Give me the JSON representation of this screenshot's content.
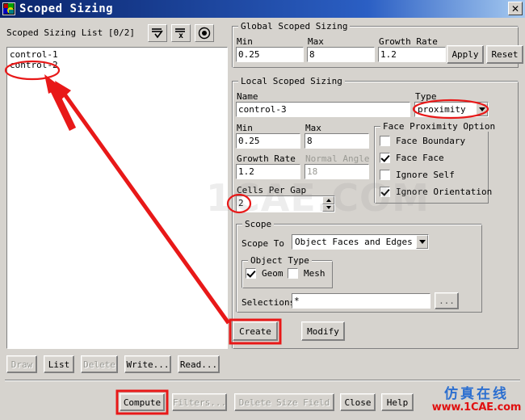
{
  "window": {
    "title": "Scoped Sizing",
    "icon": "mesh-app-icon",
    "close_label": "✕"
  },
  "left_panel": {
    "list_label": "Scoped Sizing List  [0/2]",
    "toolbar": [
      {
        "name": "select-all-icon",
        "tooltip": "Select All"
      },
      {
        "name": "deselect-all-icon",
        "tooltip": "Deselect All"
      },
      {
        "name": "highlight-icon",
        "tooltip": "Highlight"
      }
    ],
    "items": [
      {
        "label": "control-1"
      },
      {
        "label": "control-2"
      }
    ],
    "buttons": [
      {
        "label": "Draw",
        "enabled": false
      },
      {
        "label": "List",
        "enabled": true
      },
      {
        "label": "Delete",
        "enabled": false
      },
      {
        "label": "Write...",
        "enabled": true
      },
      {
        "label": "Read...",
        "enabled": true
      }
    ]
  },
  "global": {
    "title": "Global Scoped Sizing",
    "min_label": "Min",
    "min_value": "0.25",
    "max_label": "Max",
    "max_value": "8",
    "growth_label": "Growth Rate",
    "growth_value": "1.2",
    "apply_label": "Apply",
    "reset_label": "Reset"
  },
  "local": {
    "title": "Local Scoped Sizing",
    "name_label": "Name",
    "name_value": "control-3",
    "type_label": "Type",
    "type_value": "proximity",
    "min_label": "Min",
    "min_value": "0.25",
    "max_label": "Max",
    "max_value": "8",
    "growth_label": "Growth Rate",
    "growth_value": "1.2",
    "normal_angle_label": "Normal Angle",
    "normal_angle_value": "18",
    "cells_per_gap_label": "Cells Per Gap",
    "cells_per_gap_value": "2",
    "proximity": {
      "title": "Face Proximity Option",
      "options": [
        {
          "label": "Face Boundary",
          "checked": false
        },
        {
          "label": "Face Face",
          "checked": true
        },
        {
          "label": "Ignore Self",
          "checked": false
        },
        {
          "label": "Ignore Orientation",
          "checked": true
        }
      ]
    },
    "scope": {
      "title": "Scope",
      "scope_to_label": "Scope To",
      "scope_to_value": "Object Faces and Edges",
      "object_type_title": "Object Type",
      "object_types": [
        {
          "label": "Geom",
          "checked": true
        },
        {
          "label": "Mesh",
          "checked": false
        }
      ],
      "selections_label": "Selections",
      "selections_value": "*",
      "selections_browse_label": "..."
    },
    "create_label": "Create",
    "modify_label": "Modify"
  },
  "footer": {
    "buttons": [
      {
        "label": "Compute",
        "enabled": true
      },
      {
        "label": "Filters...",
        "enabled": false
      },
      {
        "label": "Delete Size Field",
        "enabled": false
      },
      {
        "label": "Close",
        "enabled": true
      },
      {
        "label": "Help",
        "enabled": true
      }
    ]
  },
  "watermark": {
    "center": "1CAE.COM",
    "brand_cn": "仿真在线",
    "brand_url": "www.1CAE.com"
  },
  "annotations": {
    "highlight_color": "#e81818",
    "marks": [
      {
        "name": "ellipse-control-2",
        "type": "ellipse"
      },
      {
        "name": "ellipse-type-proximity",
        "type": "ellipse"
      },
      {
        "name": "ellipse-cells-per-gap",
        "type": "ellipse"
      },
      {
        "name": "rect-create-button",
        "type": "rect"
      },
      {
        "name": "rect-compute-button",
        "type": "rect"
      },
      {
        "name": "arrow-list-to-create",
        "type": "arrow"
      },
      {
        "name": "arrow-create-to-list",
        "type": "arrow"
      }
    ]
  }
}
